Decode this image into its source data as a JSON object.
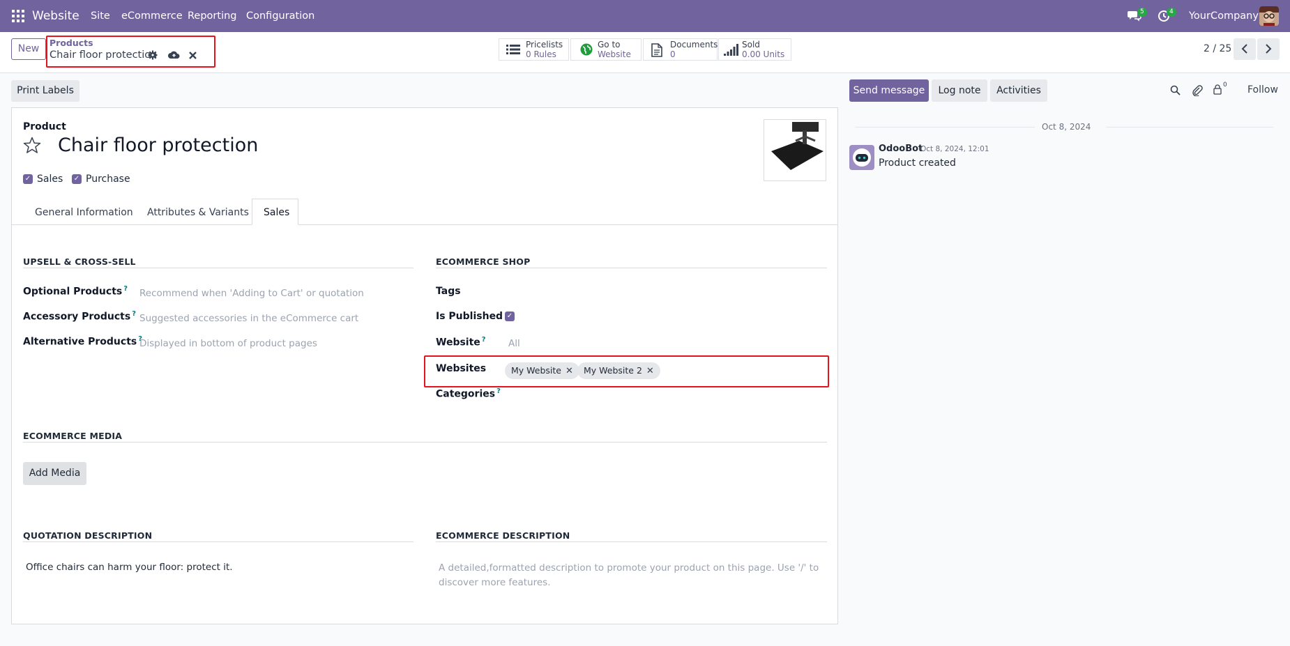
{
  "navbar": {
    "app_name": "Website",
    "menu": [
      "Site",
      "eCommerce",
      "Reporting",
      "Configuration"
    ],
    "messages_count": "5",
    "activities_count": "4",
    "company": "YourCompany",
    "bg_color": "#71639e"
  },
  "control_panel": {
    "new_label": "New",
    "breadcrumb_parent": "Products",
    "record_name": "Chair floor protection",
    "smart_buttons": [
      {
        "label": "Pricelists",
        "value": "0 Rules",
        "icon": "list-icon"
      },
      {
        "label": "Go to",
        "value": "Website",
        "icon": "globe-icon"
      },
      {
        "label": "Documents",
        "value": "0",
        "icon": "document-icon"
      },
      {
        "label": "Sold",
        "value": "0.00 Units",
        "icon": "signal-icon"
      }
    ],
    "pager": "2 / 25"
  },
  "actions": {
    "print_labels": "Print Labels"
  },
  "chatter": {
    "send_message": "Send message",
    "log_note": "Log note",
    "activities": "Activities",
    "followers_count": "0",
    "follow": "Follow",
    "date_separator": "Oct 8, 2024",
    "message": {
      "author": "OdooBot",
      "timestamp": "Oct 8, 2024, 12:01",
      "body": "Product created"
    }
  },
  "form": {
    "product_label": "Product",
    "product_name": "Chair floor protection",
    "sales_label": "Sales",
    "purchase_label": "Purchase",
    "tabs": [
      "General Information",
      "Attributes & Variants",
      "Sales"
    ],
    "active_tab": "Sales",
    "upsell": {
      "title": "UPSELL & CROSS-SELL",
      "optional_label": "Optional Products",
      "optional_placeholder": "Recommend when 'Adding to Cart' or quotation",
      "accessory_label": "Accessory Products",
      "accessory_placeholder": "Suggested accessories in the eCommerce cart",
      "alternative_label": "Alternative Products",
      "alternative_placeholder": "Displayed in bottom of product pages"
    },
    "ecommerce_shop": {
      "title": "ECOMMERCE SHOP",
      "tags_label": "Tags",
      "published_label": "Is Published",
      "website_label": "Website",
      "website_placeholder": "All",
      "websites_label": "Websites",
      "websites_tags": [
        "My Website",
        "My Website 2"
      ],
      "categories_label": "Categories"
    },
    "ecommerce_media": {
      "title": "ECOMMERCE MEDIA",
      "add_media": "Add Media"
    },
    "quotation_description": {
      "title": "QUOTATION DESCRIPTION",
      "text": "Office chairs can harm your floor: protect it."
    },
    "ecommerce_description": {
      "title": "ECOMMERCE DESCRIPTION",
      "placeholder_line1": "A detailed,formatted description to promote your product on this page. Use '/' to",
      "placeholder_line2": "discover more features."
    }
  }
}
